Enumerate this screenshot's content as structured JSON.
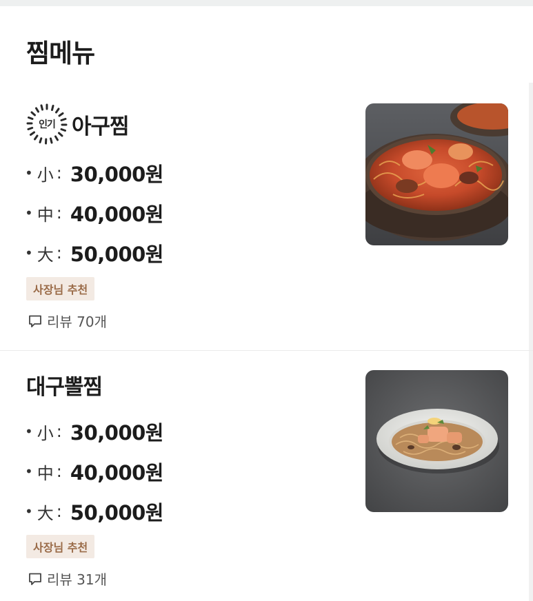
{
  "section": {
    "title": "찜메뉴"
  },
  "items": [
    {
      "badge": "인기",
      "name": "아구찜",
      "prices": [
        {
          "size": "小",
          "price": "30,000원"
        },
        {
          "size": "中",
          "price": "40,000원"
        },
        {
          "size": "大",
          "price": "50,000원"
        }
      ],
      "tag": "사장님 추천",
      "review": "리뷰 70개",
      "photo_icon": "braised-monkfish-photo"
    },
    {
      "name": "대구뽈찜",
      "prices": [
        {
          "size": "小",
          "price": "30,000원"
        },
        {
          "size": "中",
          "price": "40,000원"
        },
        {
          "size": "大",
          "price": "50,000원"
        }
      ],
      "tag": "사장님 추천",
      "review": "리뷰 31개",
      "photo_icon": "braised-cod-cheek-photo"
    }
  ],
  "colors": {
    "tag_bg": "#f3eae3",
    "tag_text": "#9a6b48",
    "text": "#1c1c1c",
    "muted": "#555555"
  }
}
